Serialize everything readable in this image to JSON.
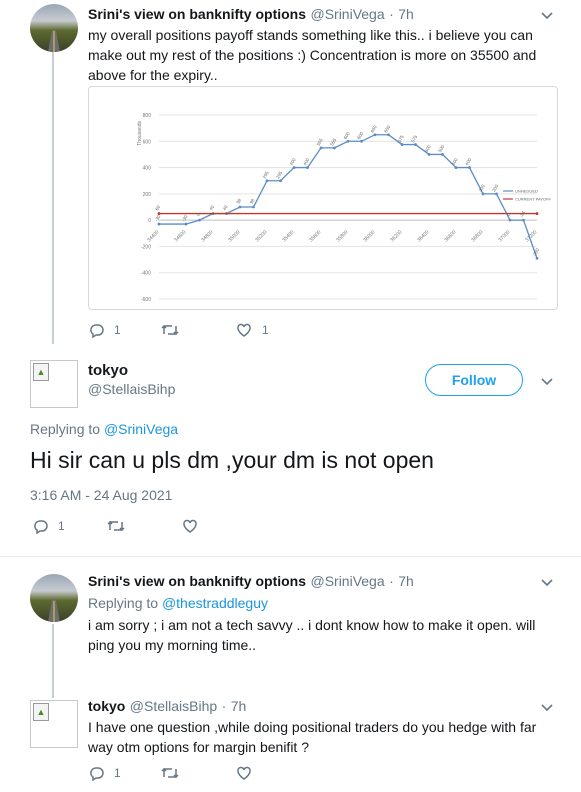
{
  "tweet1": {
    "author_name": "Srini's view on banknifty options",
    "handle": "@SriniVega",
    "dot": "·",
    "time": "7h",
    "text": "my overall positions payoff stands something like this.. i believe you can make out my rest of the positions :) Concentration is more on 35500 and above for the expiry..",
    "reply_count": "1",
    "retweet_count": "",
    "like_count": "1"
  },
  "chart_data": {
    "type": "line",
    "ylabel": "Thousands",
    "ylim": [
      -600,
      800
    ],
    "yticks": [
      "800",
      "600",
      "400",
      "200",
      "0",
      "-200",
      "-400",
      "-600"
    ],
    "xticks": [
      "34400",
      "34600",
      "34800",
      "35000",
      "35200",
      "35400",
      "35600",
      "35800",
      "36000",
      "36200",
      "36400",
      "36600",
      "36800",
      "37000",
      "37200"
    ],
    "series": [
      {
        "name": "UNHEDGED",
        "color": "#5b8cc7",
        "x": [
          34400,
          34600,
          34700,
          34800,
          34900,
          35000,
          35100,
          35200,
          35300,
          35400,
          35500,
          35600,
          35700,
          35800,
          35900,
          36000,
          36100,
          36200,
          36300,
          36400,
          36500,
          36600,
          36700,
          36800,
          36900,
          37000,
          37100,
          37200
        ],
        "values": [
          -30,
          -30,
          0,
          50,
          50,
          100,
          100,
          300,
          300,
          400,
          400,
          550,
          550,
          600,
          600,
          650,
          650,
          575,
          575,
          500,
          500,
          400,
          400,
          200,
          200,
          0,
          0,
          -290
        ],
        "labels": [
          "-30",
          "-30",
          "0",
          "40",
          "40",
          "98",
          "98",
          "295",
          "295",
          "400",
          "400",
          "555",
          "555",
          "600",
          "600",
          "650",
          "650",
          "575",
          "575",
          "500",
          "500",
          "400",
          "400",
          "200",
          "200",
          "0",
          "-14",
          "-380"
        ]
      },
      {
        "name": "CURRENT PAYOFF",
        "color": "#c0392b",
        "x": [
          34400,
          37200
        ],
        "values": [
          50,
          50
        ],
        "labels": [
          "60"
        ]
      }
    ],
    "grid": true,
    "legend": "right"
  },
  "tweet2": {
    "author_name": "tokyo",
    "handle": "@StellaisBihp",
    "follow_label": "Follow",
    "replying_label": "Replying to",
    "replying_to": "@SriniVega",
    "text": "Hi sir can u pls dm ,your dm is not open",
    "timestamp": "3:16 AM - 24 Aug 2021",
    "reply_count": "1",
    "retweet_count": "",
    "like_count": ""
  },
  "tweet3": {
    "author_name": "Srini's view on banknifty options",
    "handle": "@SriniVega",
    "dot": "·",
    "time": "7h",
    "replying_label": "Replying to",
    "replying_to": "@thestraddleguy",
    "text": "i am sorry ; i am not a tech savvy .. i dont know how to make it open.  will ping you my morning time..",
    "reply_count": "",
    "retweet_count": "",
    "like_count": ""
  },
  "tweet4": {
    "author_name": "tokyo",
    "handle": "@StellaisBihp",
    "dot": "·",
    "time": "7h",
    "text": "I have one question ,while doing positional traders do you hedge with far way otm options for margin benifit ?",
    "reply_count": "1",
    "retweet_count": "",
    "like_count": ""
  },
  "icons": {
    "reply": "reply-icon",
    "retweet": "retweet-icon",
    "like": "heart-icon",
    "more": "chevron-down-icon"
  },
  "colors": {
    "link": "#1b95e0",
    "follow": "#1da1f2",
    "thread_line": "#c4cfd6"
  }
}
